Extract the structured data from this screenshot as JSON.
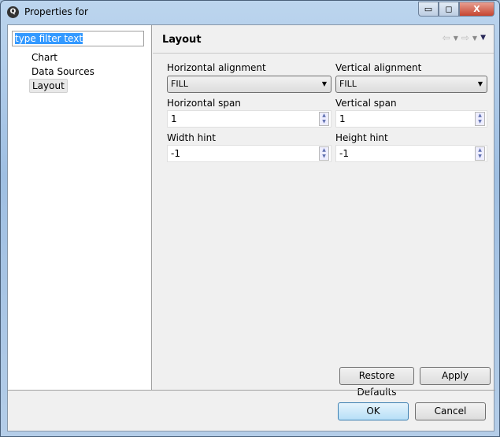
{
  "window": {
    "title": "Properties for",
    "minimize": "▭",
    "maximize": "◻",
    "close": "X",
    "app_icon": "Q"
  },
  "filter": {
    "value": "type filter text"
  },
  "tree": {
    "items": [
      {
        "label": "Chart"
      },
      {
        "label": "Data Sources"
      },
      {
        "label": "Layout",
        "selected": true
      }
    ]
  },
  "page": {
    "title": "Layout",
    "nav": {
      "back": "⇦",
      "forward": "⇨",
      "dropdown": "▼",
      "menu": "▼"
    },
    "fields": {
      "horizontal_alignment": {
        "label": "Horizontal alignment",
        "value": "FILL"
      },
      "vertical_alignment": {
        "label": "Vertical alignment",
        "value": "FILL"
      },
      "horizontal_span": {
        "label": "Horizontal span",
        "value": "1"
      },
      "vertical_span": {
        "label": "Vertical span",
        "value": "1"
      },
      "width_hint": {
        "label": "Width hint",
        "value": "-1"
      },
      "height_hint": {
        "label": "Height hint",
        "value": "-1"
      }
    },
    "restore_defaults": "Restore Defaults",
    "apply": "Apply"
  },
  "dialog": {
    "ok": "OK",
    "cancel": "Cancel"
  },
  "spinner": {
    "up": "▲",
    "down": "▼"
  }
}
